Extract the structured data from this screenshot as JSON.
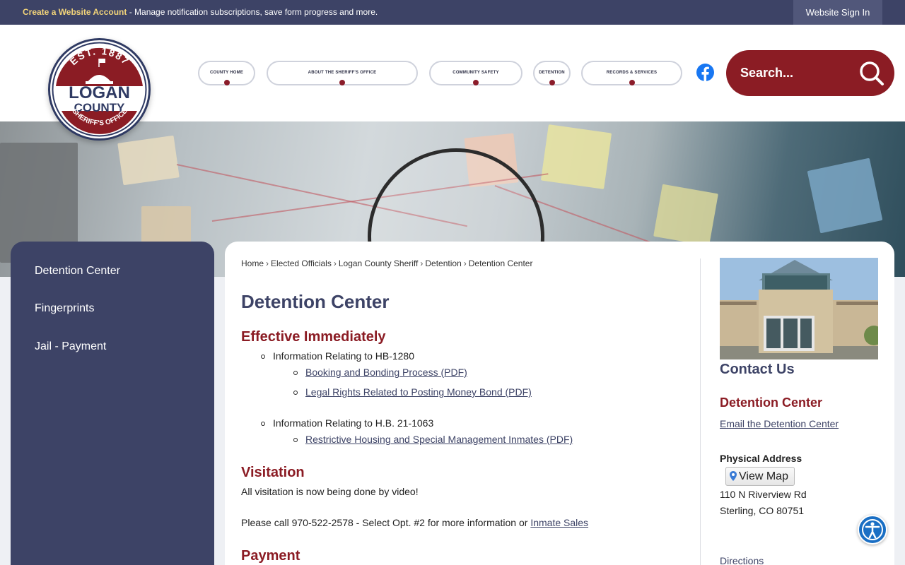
{
  "topbar": {
    "create_account": "Create a Website Account",
    "message": " - Manage notification subscriptions, save form progress and more.",
    "sign_in": "Website Sign In"
  },
  "logo": {
    "est": "EST. 1887",
    "line1": "LOGAN",
    "line2": "COUNTY",
    "line3": "SHERIFF'S OFFICE"
  },
  "nav": [
    {
      "label": "County Home"
    },
    {
      "label": "About the Sheriff's Office"
    },
    {
      "label": "Community Safety"
    },
    {
      "label": "Detention"
    },
    {
      "label": "Records & Services"
    }
  ],
  "search": {
    "placeholder": "Search..."
  },
  "sidebar": {
    "items": [
      {
        "label": "Detention Center"
      },
      {
        "label": "Fingerprints"
      },
      {
        "label": "Jail - Payment"
      }
    ]
  },
  "breadcrumb": [
    "Home",
    "Elected Officials",
    "Logan County Sheriff",
    "Detention",
    "Detention Center"
  ],
  "breadcrumb_sep": "›",
  "main": {
    "title": "Detention Center",
    "effective": {
      "heading": "Effective Immediately",
      "item1": "Information Relating to HB-1280",
      "link1": "Booking and Bonding Process (PDF)",
      "link2": "Legal Rights Related to Posting Money Bond (PDF)",
      "item2": "Information Relating to H.B. 21-1063",
      "link3": "Restrictive Housing and Special Management Inmates (PDF)"
    },
    "visitation": {
      "heading": "Visitation",
      "line1": "All visitation is now being done by video!",
      "line2": "Please call 970-522-2578 - Select Opt. #2 for more information or",
      "link": "Inmate Sales"
    },
    "payment": {
      "heading": "Payment"
    }
  },
  "contact": {
    "title": "Contact Us",
    "name": "Detention Center",
    "email_link": "Email the Detention Center",
    "address_label": "Physical Address",
    "map_button": "View Map",
    "street": "110 N Riverview Rd",
    "city": "Sterling, CO 80751",
    "directions": "Directions"
  },
  "colors": {
    "navy": "#3d4366",
    "maroon": "#8b1c24",
    "gold": "#f2d47a"
  }
}
